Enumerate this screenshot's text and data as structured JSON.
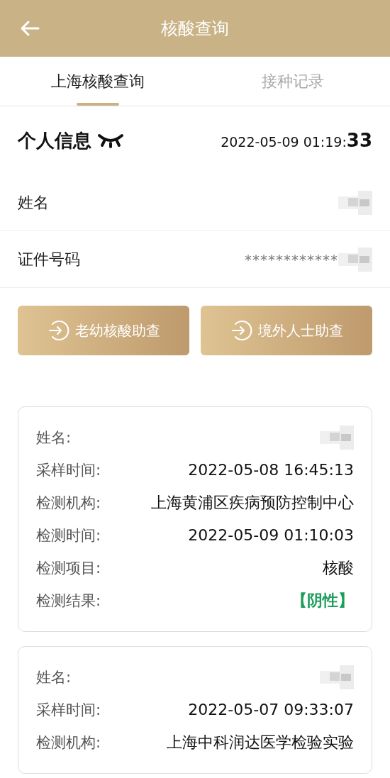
{
  "header": {
    "title": "核酸查询"
  },
  "tabs": [
    {
      "label": "上海核酸查询",
      "selected": true
    },
    {
      "label": "接种记录",
      "selected": false
    }
  ],
  "personal": {
    "title": "个人信息",
    "timestamp": "2022-05-09 01:19:",
    "seconds": "33",
    "rows": [
      {
        "label": "姓名",
        "kind": "blurred"
      },
      {
        "label": "证件号码",
        "kind": "masked",
        "value": "************"
      }
    ]
  },
  "buttons": [
    "老幼核酸助查",
    "境外人士助查"
  ],
  "records": [
    {
      "fields": [
        {
          "label": "姓名:",
          "kind": "blurred"
        },
        {
          "label": "采样时间:",
          "kind": "text",
          "value": "2022-05-08 16:45:13"
        },
        {
          "label": "检测机构:",
          "kind": "text",
          "value": "上海黄浦区疾病预防控制中心"
        },
        {
          "label": "检测时间:",
          "kind": "text",
          "value": "2022-05-09 01:10:03"
        },
        {
          "label": "检测项目:",
          "kind": "text",
          "value": "核酸"
        },
        {
          "label": "检测结果:",
          "kind": "result",
          "value": "【阴性】"
        }
      ]
    },
    {
      "fields": [
        {
          "label": "姓名:",
          "kind": "blurred"
        },
        {
          "label": "采样时间:",
          "kind": "text",
          "value": "2022-05-07 09:33:07"
        },
        {
          "label": "检测机构:",
          "kind": "text",
          "value": "上海中科润达医学检验实验"
        }
      ]
    }
  ]
}
